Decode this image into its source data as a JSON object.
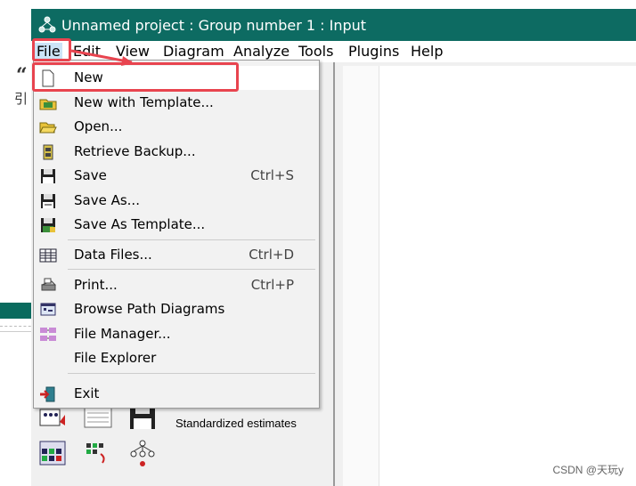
{
  "window": {
    "title": "Unnamed project : Group number 1 : Input"
  },
  "menubar": {
    "items": [
      "File",
      "Edit",
      "View",
      "Diagram",
      "Analyze",
      "Tools",
      "Plugins",
      "Help"
    ]
  },
  "file_menu": {
    "items": [
      {
        "label": "New",
        "shortcut": "",
        "icon": "new-document-icon"
      },
      {
        "label": "New with Template...",
        "shortcut": "",
        "icon": "folder-template-icon"
      },
      {
        "label": "Open...",
        "shortcut": "",
        "icon": "open-folder-icon"
      },
      {
        "label": "Retrieve Backup...",
        "shortcut": "",
        "icon": "backup-icon"
      },
      {
        "label": "Save",
        "shortcut": "Ctrl+S",
        "icon": "save-icon"
      },
      {
        "label": "Save As...",
        "shortcut": "",
        "icon": "save-as-icon"
      },
      {
        "label": "Save As  Template...",
        "shortcut": "",
        "icon": "save-template-icon"
      },
      {
        "label": "Data Files...",
        "shortcut": "Ctrl+D",
        "icon": "data-files-icon"
      },
      {
        "label": "Print...",
        "shortcut": "Ctrl+P",
        "icon": "printer-icon"
      },
      {
        "label": "Browse Path Diagrams",
        "shortcut": "",
        "icon": "browse-diagrams-icon"
      },
      {
        "label": "File Manager...",
        "shortcut": "",
        "icon": "file-manager-icon"
      },
      {
        "label": "File Explorer",
        "shortcut": "",
        "icon": ""
      },
      {
        "label": "Exit",
        "shortcut": "",
        "icon": "exit-icon"
      }
    ]
  },
  "panel": {
    "estimates_label": "Standardized estimates"
  },
  "background": {
    "quote_glyph": "“",
    "cjk_fragment": "引"
  },
  "watermark": "CSDN @天玩y",
  "colors": {
    "titlebar": "#0d6b62",
    "highlight": "#cce4f7",
    "annotation": "#e8444f"
  }
}
